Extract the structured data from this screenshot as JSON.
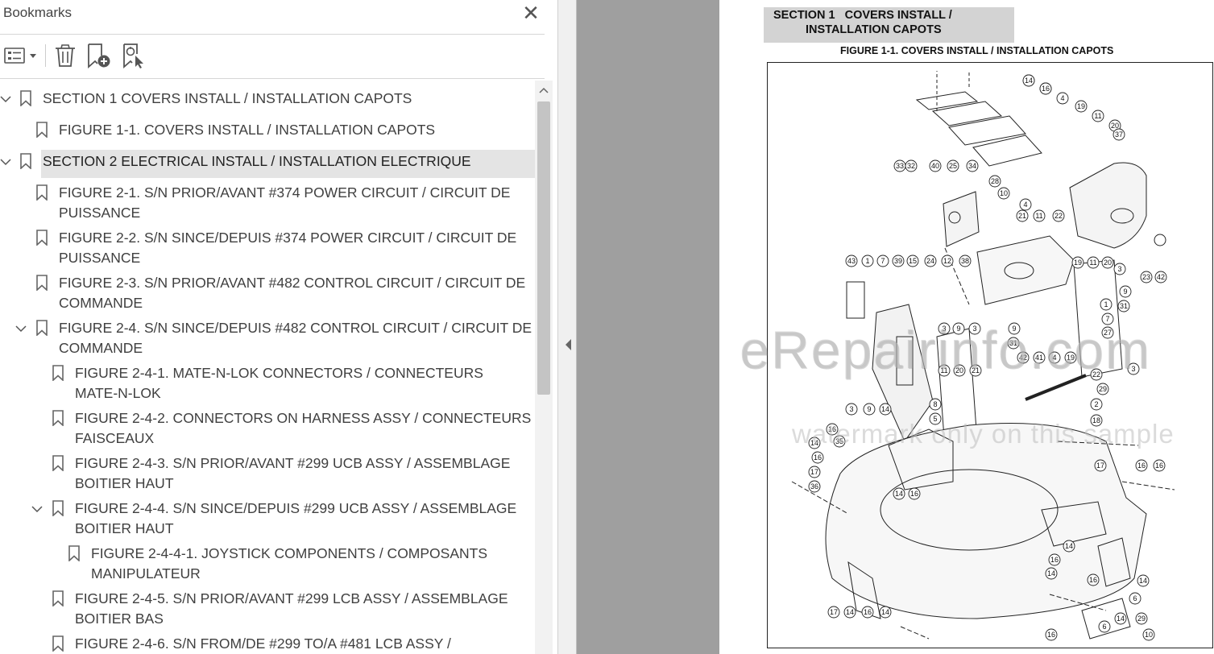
{
  "panel": {
    "title": "Bookmarks",
    "close_icon": "close-icon",
    "toolbar": [
      {
        "name": "options-menu-button",
        "icon": "list-options-icon"
      },
      {
        "name": "delete-bookmark-button",
        "icon": "trash-icon"
      },
      {
        "name": "add-bookmark-button",
        "icon": "bookmark-add-icon"
      },
      {
        "name": "find-bookmark-button",
        "icon": "bookmark-find-icon"
      }
    ]
  },
  "bookmarks": [
    {
      "label": "SECTION 1 COVERS INSTALL / INSTALLATION CAPOTS",
      "level": 0,
      "expanded": true
    },
    {
      "label": "FIGURE 1-1. COVERS INSTALL / INSTALLATION CAPOTS",
      "level": 1
    },
    {
      "label": "SECTION 2 ELECTRICAL INSTALL / INSTALLATION ELECTRIQUE",
      "level": 0,
      "expanded": true,
      "selected": true
    },
    {
      "label": "FIGURE 2-1. S/N PRIOR/AVANT #374 POWER CIRCUIT / CIRCUIT DE",
      "label2": "PUISSANCE",
      "level": 1
    },
    {
      "label": "FIGURE 2-2. S/N SINCE/DEPUIS #374 POWER CIRCUIT / CIRCUIT DE",
      "label2": "PUISSANCE",
      "level": 1
    },
    {
      "label": "FIGURE 2-3. S/N PRIOR/AVANT #482 CONTROL CIRCUIT / CIRCUIT DE",
      "label2": "COMMANDE",
      "level": 1
    },
    {
      "label": "FIGURE 2-4. S/N SINCE/DEPUIS #482 CONTROL CIRCUIT / CIRCUIT DE",
      "label2": "COMMANDE",
      "level": 1,
      "expanded": true
    },
    {
      "label": "FIGURE 2-4-1. MATE-N-LOK CONNECTORS / CONNECTEURS",
      "label2": "MATE-N-LOK",
      "level": 2
    },
    {
      "label": "FIGURE 2-4-2. CONNECTORS ON HARNESS ASSY / CONNECTEURS SUR",
      "label2": "FAISCEAUX",
      "level": 2
    },
    {
      "label": "FIGURE 2-4-3. S/N PRIOR/AVANT #299 UCB ASSY / ASSEMBLAGE",
      "label2": "BOITIER HAUT",
      "level": 2
    },
    {
      "label": "FIGURE 2-4-4. S/N SINCE/DEPUIS #299 UCB ASSY / ASSEMBLAGE",
      "label2": "BOITIER HAUT",
      "level": 2,
      "expanded": true
    },
    {
      "label": "FIGURE 2-4-4-1. JOYSTICK COMPONENTS / COMPOSANTS",
      "label2": "MANIPULATEUR",
      "level": 3
    },
    {
      "label": "FIGURE 2-4-5. S/N PRIOR/AVANT #299 LCB ASSY / ASSEMBLAGE",
      "label2": "BOITIER BAS",
      "level": 2
    },
    {
      "label": "FIGURE 2-4-6. S/N FROM/DE #299 TO/A #481 LCB ASSY /",
      "level": 2
    }
  ],
  "document": {
    "section_line1": "SECTION 1   COVERS INSTALL /",
    "section_line2": "INSTALLATION CAPOTS",
    "figure_title": "FIGURE 1-1. COVERS INSTALL / INSTALLATION CAPOTS",
    "watermark_main": "eRepairinfo.com",
    "watermark_sub": "watermark only on this sample",
    "callouts": [
      "13",
      "30",
      "4",
      "19",
      "11",
      "20",
      "37",
      "33",
      "32",
      "40",
      "25",
      "34",
      "28",
      "10",
      "4",
      "21",
      "11",
      "22",
      "42",
      "23",
      "43",
      "1",
      "7",
      "39",
      "15",
      "24",
      "12",
      "38",
      "19",
      "11",
      "20",
      "3",
      "9",
      "31",
      "1",
      "7",
      "27",
      "3",
      "9",
      "3",
      "9",
      "31",
      "42",
      "41",
      "4",
      "19",
      "11",
      "20",
      "21",
      "3",
      "22",
      "29",
      "2",
      "18",
      "8",
      "5",
      "3",
      "9",
      "14",
      "16",
      "35",
      "14",
      "16",
      "17",
      "36",
      "14",
      "16",
      "17",
      "16",
      "16",
      "14",
      "16",
      "14",
      "17",
      "14",
      "16",
      "14",
      "14",
      "6",
      "29",
      "16",
      "10",
      "6",
      "14",
      "16",
      "14",
      "16"
    ]
  },
  "colors": {
    "gray_area": "#9f9f9f",
    "selection": "#e4e4e4",
    "section_box": "#d3d3d3"
  }
}
